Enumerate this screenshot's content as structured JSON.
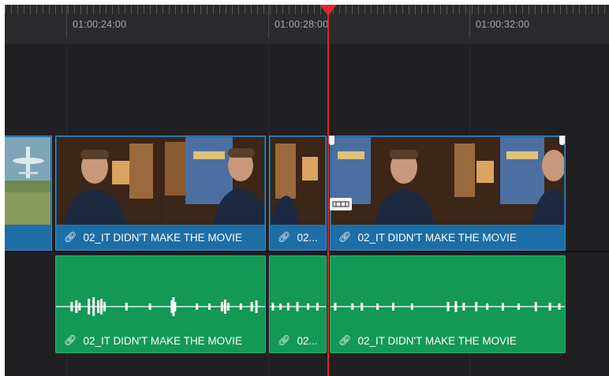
{
  "ruler": {
    "timecodes": [
      "01:00:24:00",
      "01:00:28:00",
      "01:00:32:00"
    ]
  },
  "video_track": {
    "clips": [
      {
        "label": ""
      },
      {
        "label": "02_IT DIDN'T MAKE THE MOVIE"
      },
      {
        "label": "02..."
      },
      {
        "label": "02_IT DIDN'T MAKE THE MOVIE"
      }
    ]
  },
  "audio_track": {
    "clips": [
      {
        "label": "02_IT DIDN'T MAKE THE MOVIE"
      },
      {
        "label": "02..."
      },
      {
        "label": "02_IT DIDN'T MAKE THE MOVIE"
      }
    ]
  },
  "icons": {
    "link": "link-icon",
    "playhead": "playhead-icon",
    "razor": "razor-cursor-icon"
  },
  "colors": {
    "video_clip": "#1e6ea6",
    "audio_clip": "#139856",
    "playhead": "#d8262b",
    "background": "#202023"
  }
}
